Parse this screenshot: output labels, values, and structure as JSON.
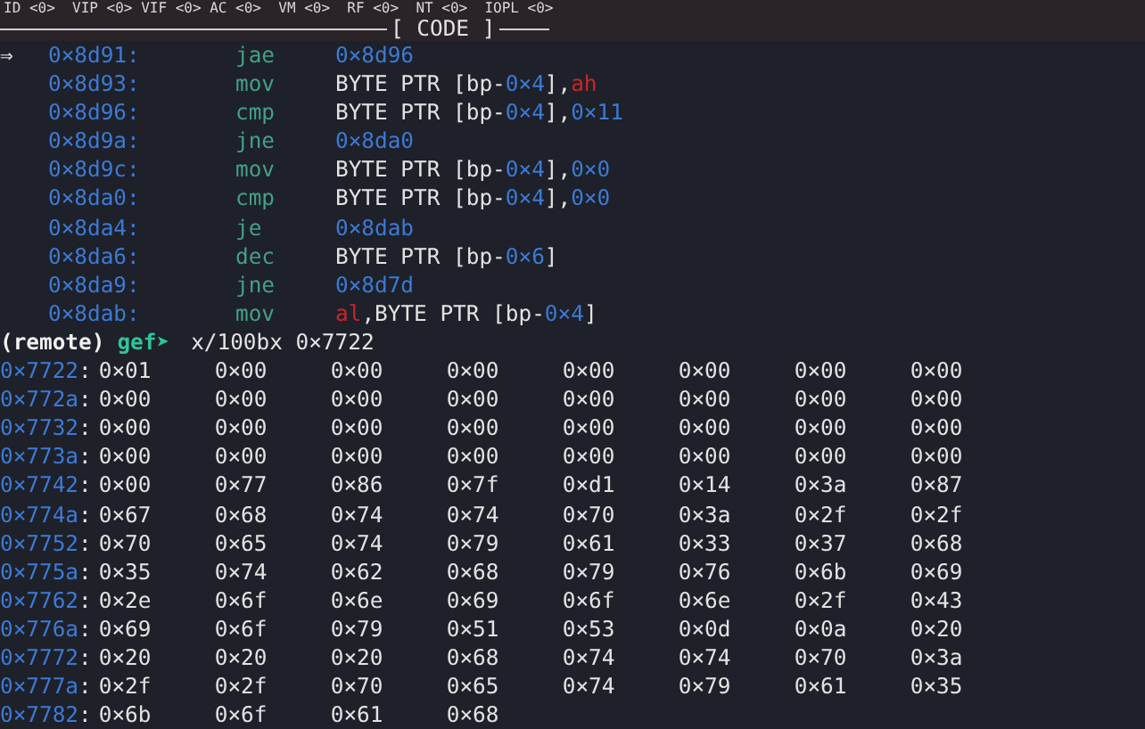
{
  "status_flags": "ID <0>  VIP <0> VIF <0> AC <0>  VM <0>  RF <0>  NT <0>  IOPL <0>",
  "section_header": {
    "title": "[ CODE ]"
  },
  "code": {
    "marker": "⇒",
    "lines": [
      {
        "current": true,
        "address": "0×8d91:",
        "mnemonic": "jae",
        "operands": [
          {
            "kind": "number",
            "text": "0×8d96"
          }
        ]
      },
      {
        "current": false,
        "address": "0×8d93:",
        "mnemonic": "mov",
        "operands": [
          {
            "kind": "plain",
            "text": "BYTE PTR [bp-"
          },
          {
            "kind": "number",
            "text": "0×4"
          },
          {
            "kind": "plain",
            "text": "],"
          },
          {
            "kind": "register",
            "text": "ah"
          }
        ]
      },
      {
        "current": false,
        "address": "0×8d96:",
        "mnemonic": "cmp",
        "operands": [
          {
            "kind": "plain",
            "text": "BYTE PTR [bp-"
          },
          {
            "kind": "number",
            "text": "0×4"
          },
          {
            "kind": "plain",
            "text": "],"
          },
          {
            "kind": "number",
            "text": "0×11"
          }
        ]
      },
      {
        "current": false,
        "address": "0×8d9a:",
        "mnemonic": "jne",
        "operands": [
          {
            "kind": "number",
            "text": "0×8da0"
          }
        ]
      },
      {
        "current": false,
        "address": "0×8d9c:",
        "mnemonic": "mov",
        "operands": [
          {
            "kind": "plain",
            "text": "BYTE PTR [bp-"
          },
          {
            "kind": "number",
            "text": "0×4"
          },
          {
            "kind": "plain",
            "text": "],"
          },
          {
            "kind": "number",
            "text": "0×0"
          }
        ]
      },
      {
        "current": false,
        "address": "0×8da0:",
        "mnemonic": "cmp",
        "operands": [
          {
            "kind": "plain",
            "text": "BYTE PTR [bp-"
          },
          {
            "kind": "number",
            "text": "0×4"
          },
          {
            "kind": "plain",
            "text": "],"
          },
          {
            "kind": "number",
            "text": "0×0"
          }
        ]
      },
      {
        "current": false,
        "address": "0×8da4:",
        "mnemonic": "je",
        "operands": [
          {
            "kind": "number",
            "text": "0×8dab"
          }
        ]
      },
      {
        "current": false,
        "address": "0×8da6:",
        "mnemonic": "dec",
        "operands": [
          {
            "kind": "plain",
            "text": "BYTE PTR [bp-"
          },
          {
            "kind": "number",
            "text": "0×6"
          },
          {
            "kind": "plain",
            "text": "]"
          }
        ]
      },
      {
        "current": false,
        "address": "0×8da9:",
        "mnemonic": "jne",
        "operands": [
          {
            "kind": "number",
            "text": "0×8d7d"
          }
        ]
      },
      {
        "current": false,
        "address": "0×8dab:",
        "mnemonic": "mov",
        "operands": [
          {
            "kind": "register",
            "text": "al"
          },
          {
            "kind": "plain",
            "text": ",BYTE PTR [bp-"
          },
          {
            "kind": "number",
            "text": "0×4"
          },
          {
            "kind": "plain",
            "text": "]"
          }
        ]
      }
    ]
  },
  "prompt": {
    "context": "(remote)",
    "name": "gef➤",
    "command": "x/100bx 0×7722"
  },
  "memory_rows": [
    {
      "address": "0×7722",
      "separator": ":",
      "bytes": [
        "0×01",
        "0×00",
        "0×00",
        "0×00",
        "0×00",
        "0×00",
        "0×00",
        "0×00"
      ]
    },
    {
      "address": "0×772a",
      "separator": ":",
      "bytes": [
        "0×00",
        "0×00",
        "0×00",
        "0×00",
        "0×00",
        "0×00",
        "0×00",
        "0×00"
      ]
    },
    {
      "address": "0×7732",
      "separator": ":",
      "bytes": [
        "0×00",
        "0×00",
        "0×00",
        "0×00",
        "0×00",
        "0×00",
        "0×00",
        "0×00"
      ]
    },
    {
      "address": "0×773a",
      "separator": ":",
      "bytes": [
        "0×00",
        "0×00",
        "0×00",
        "0×00",
        "0×00",
        "0×00",
        "0×00",
        "0×00"
      ]
    },
    {
      "address": "0×7742",
      "separator": ":",
      "bytes": [
        "0×00",
        "0×77",
        "0×86",
        "0×7f",
        "0×d1",
        "0×14",
        "0×3a",
        "0×87"
      ]
    },
    {
      "address": "0×774a",
      "separator": ":",
      "bytes": [
        "0×67",
        "0×68",
        "0×74",
        "0×74",
        "0×70",
        "0×3a",
        "0×2f",
        "0×2f"
      ]
    },
    {
      "address": "0×7752",
      "separator": ":",
      "bytes": [
        "0×70",
        "0×65",
        "0×74",
        "0×79",
        "0×61",
        "0×33",
        "0×37",
        "0×68"
      ]
    },
    {
      "address": "0×775a",
      "separator": ":",
      "bytes": [
        "0×35",
        "0×74",
        "0×62",
        "0×68",
        "0×79",
        "0×76",
        "0×6b",
        "0×69"
      ]
    },
    {
      "address": "0×7762",
      "separator": ":",
      "bytes": [
        "0×2e",
        "0×6f",
        "0×6e",
        "0×69",
        "0×6f",
        "0×6e",
        "0×2f",
        "0×43"
      ]
    },
    {
      "address": "0×776a",
      "separator": ":",
      "bytes": [
        "0×69",
        "0×6f",
        "0×79",
        "0×51",
        "0×53",
        "0×0d",
        "0×0a",
        "0×20"
      ]
    },
    {
      "address": "0×7772",
      "separator": ":",
      "bytes": [
        "0×20",
        "0×20",
        "0×20",
        "0×68",
        "0×74",
        "0×74",
        "0×70",
        "0×3a"
      ]
    },
    {
      "address": "0×777a",
      "separator": ":",
      "bytes": [
        "0×2f",
        "0×2f",
        "0×70",
        "0×65",
        "0×74",
        "0×79",
        "0×61",
        "0×35"
      ]
    },
    {
      "address": "0×7782",
      "separator": ":",
      "bytes": [
        "0×6b",
        "0×6f",
        "0×61",
        "0×68"
      ]
    }
  ]
}
